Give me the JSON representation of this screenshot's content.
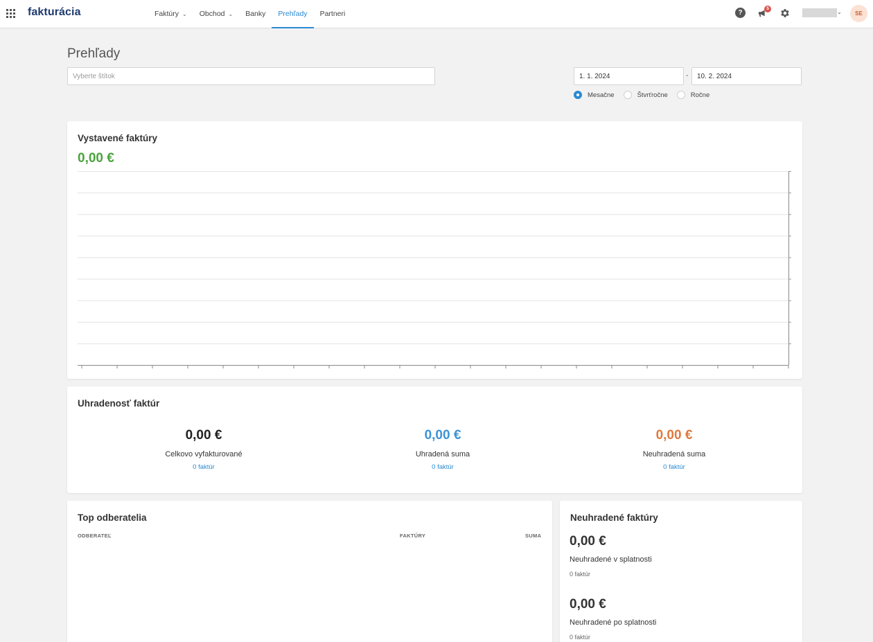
{
  "header": {
    "logo": "fakturácia",
    "nav": [
      {
        "label": "Faktúry",
        "dropdown": true
      },
      {
        "label": "Obchod",
        "dropdown": true
      },
      {
        "label": "Banky",
        "dropdown": false
      },
      {
        "label": "Prehľady",
        "dropdown": false,
        "active": true
      },
      {
        "label": "Partneri",
        "dropdown": false
      }
    ],
    "notifications_count": "5",
    "avatar_initials": "SE",
    "icons": [
      "apps-grid-icon",
      "help-icon",
      "megaphone-icon",
      "gear-icon",
      "chevron-down-icon"
    ]
  },
  "page": {
    "title": "Prehľady",
    "tag_placeholder": "Vyberte štítok",
    "date_from": "1. 1. 2024",
    "date_separator": "-",
    "date_to": "10. 2. 2024",
    "periods": [
      {
        "label": "Mesačne",
        "checked": true
      },
      {
        "label": "Štvrťročne",
        "checked": false
      },
      {
        "label": "Ročne",
        "checked": false
      }
    ]
  },
  "issued": {
    "title": "Vystavené faktúry",
    "amount": "0,00 €",
    "color": "#4ba33e"
  },
  "payment": {
    "title": "Uhradenosť faktúr",
    "stats": [
      {
        "amount": "0,00 €",
        "label": "Celkovo vyfakturované",
        "link": "0 faktúr",
        "color": "#222222"
      },
      {
        "amount": "0,00 €",
        "label": "Uhradená suma",
        "link": "0 faktúr",
        "color": "#3d93d6"
      },
      {
        "amount": "0,00 €",
        "label": "Neuhradená suma",
        "link": "0 faktúr",
        "color": "#de7a3e"
      }
    ]
  },
  "top_customers": {
    "title": "Top odberatelia",
    "columns": [
      "ODBERATEĽ",
      "FAKTÚRY",
      "SUMA"
    ],
    "rows": []
  },
  "unpaid": {
    "title": "Neuhradené faktúry",
    "items": [
      {
        "amount": "0,00 €",
        "label": "Neuhradené v splatnosti",
        "count": "0 faktúr"
      },
      {
        "amount": "0,00 €",
        "label": "Neuhradené po splatnosti",
        "count": "0 faktúr"
      }
    ]
  },
  "accent_color": "#2b8ad1"
}
